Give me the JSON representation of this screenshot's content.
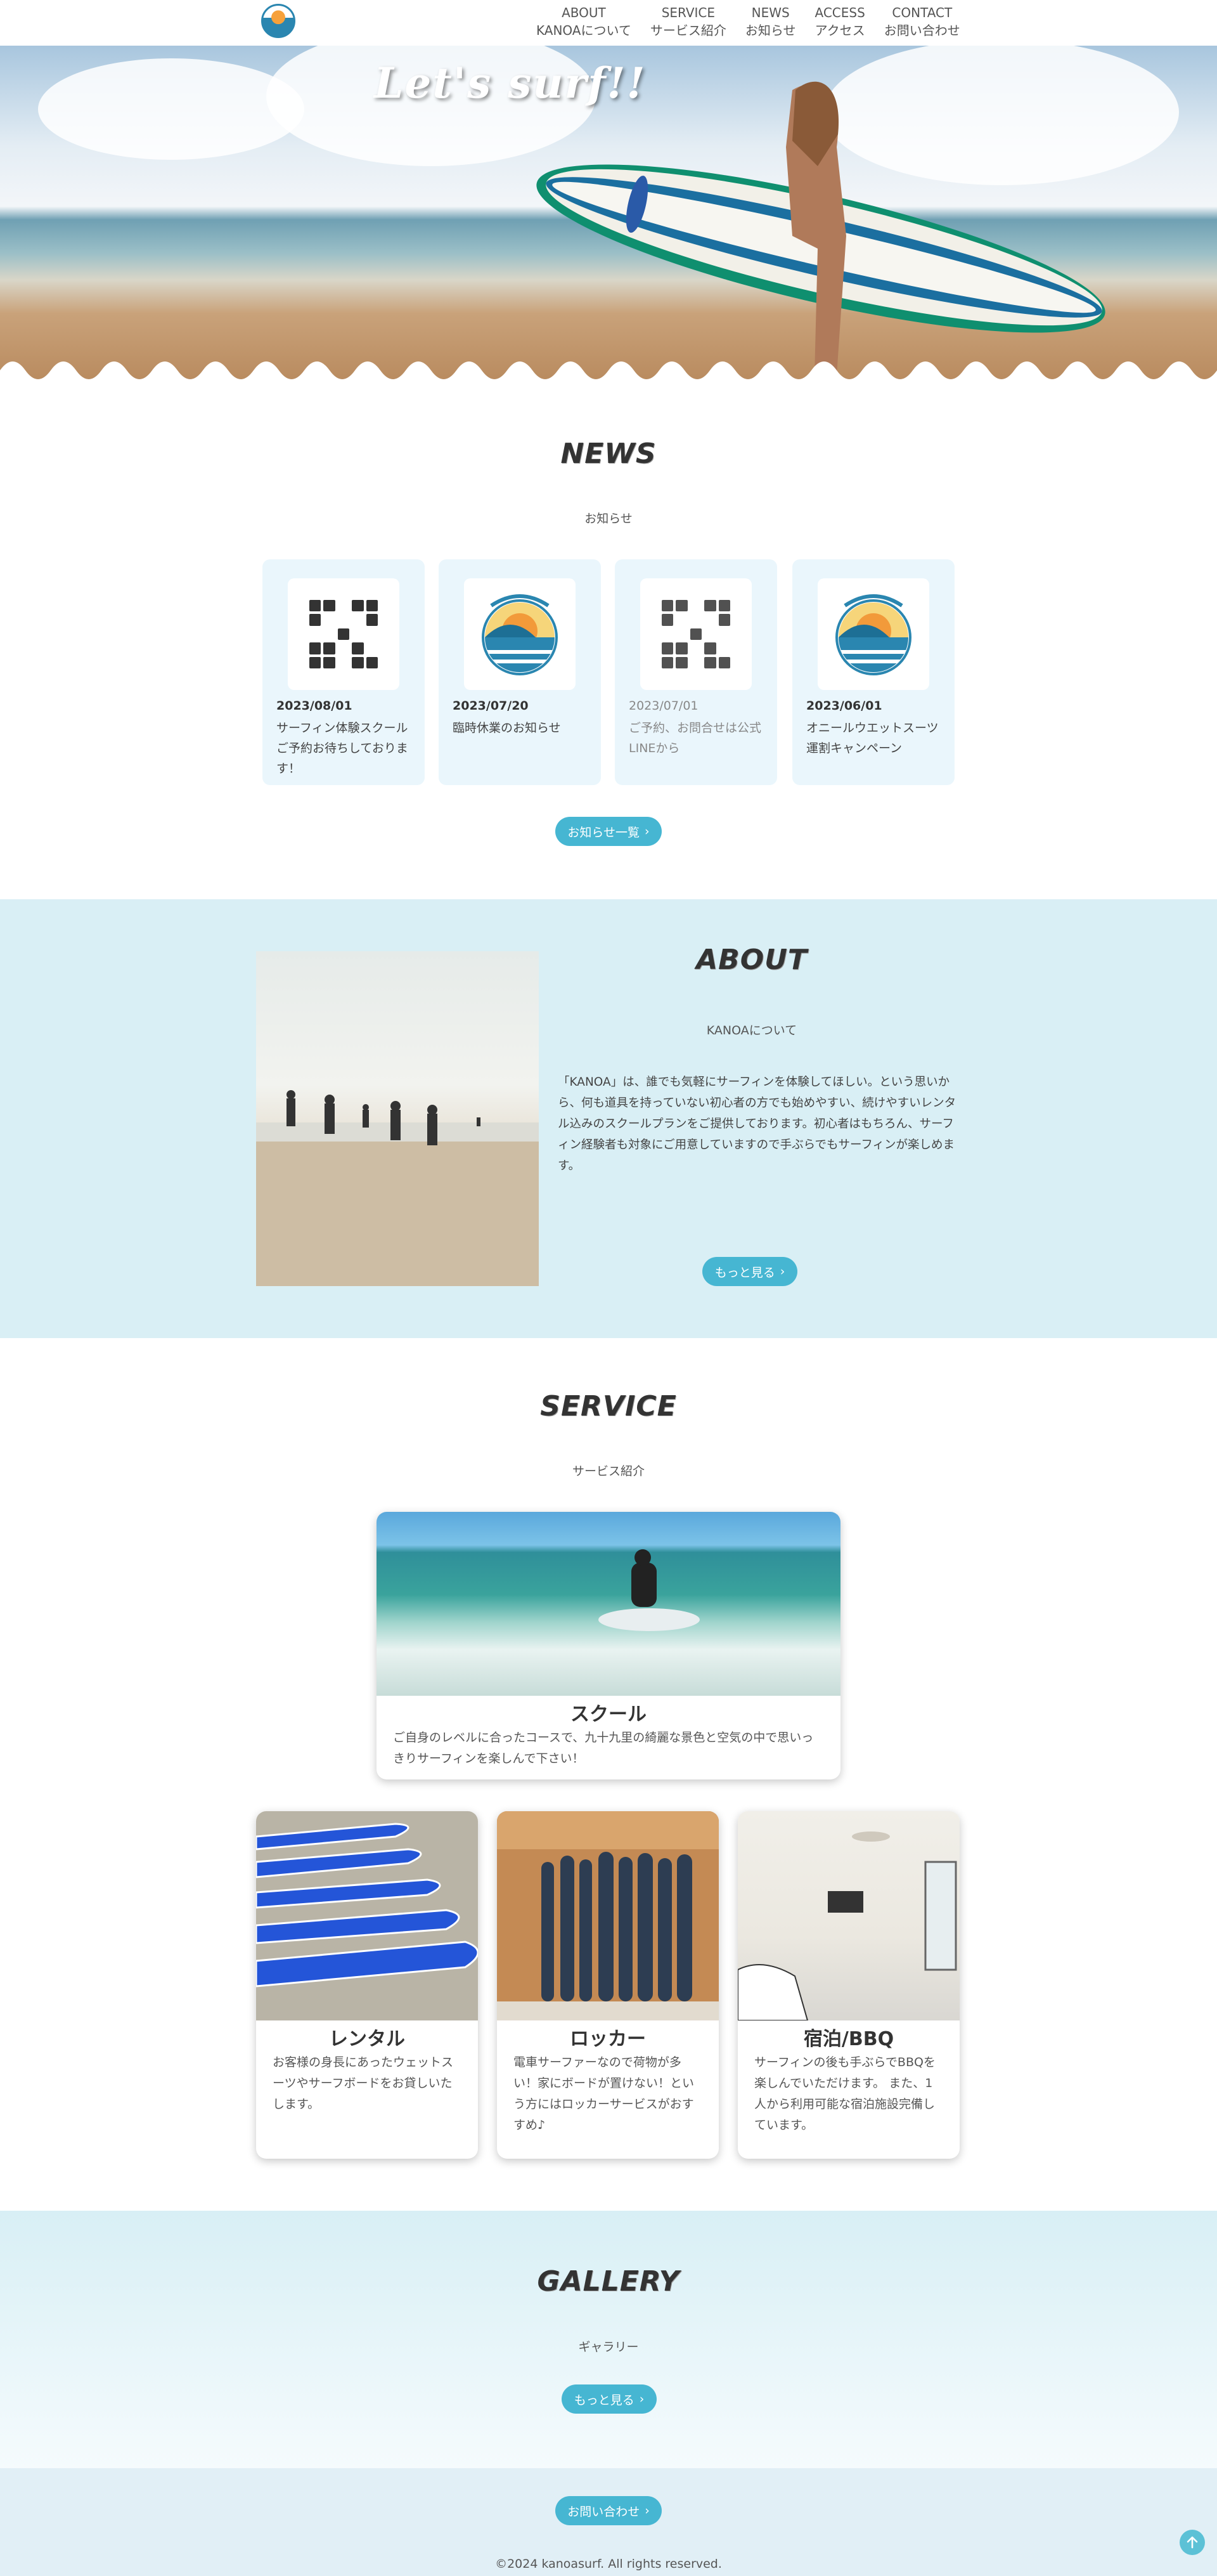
{
  "header": {
    "logo_alt": "KANOA SURF",
    "nav": [
      {
        "en": "ABOUT",
        "ja": "KANOAについて"
      },
      {
        "en": "SERVICE",
        "ja": "サービス紹介"
      },
      {
        "en": "NEWS",
        "ja": "お知らせ"
      },
      {
        "en": "ACCESS",
        "ja": "アクセス"
      },
      {
        "en": "CONTACT",
        "ja": "お問い合わせ"
      }
    ]
  },
  "hero": {
    "title": "Let's surf!!"
  },
  "news": {
    "title": "NEWS",
    "subtitle": "お知らせ",
    "items": [
      {
        "date": "2023/08/01",
        "text": "サーフィン体験スクールご予約お待ちしております！",
        "thumb": "qr-code-icon"
      },
      {
        "date": "2023/07/20",
        "text": "臨時休業のお知らせ",
        "thumb": "kanoa-surf-emblem"
      },
      {
        "date": "2023/07/01",
        "text": "ご予約、お問合せは公式LINEから",
        "thumb": "qr-code-icon"
      },
      {
        "date": "2023/06/01",
        "text": "オニールウエットスーツ運割キャンペーン",
        "thumb": "kanoa-surf-emblem"
      }
    ],
    "more_label": "お知らせ一覧"
  },
  "about": {
    "title": "ABOUT",
    "subtitle": "KANOAについて",
    "body": "「KANOA」は、誰でも気軽にサーフィンを体験してほしい。という思いから、何も道具を持っていない初心者の方でも始めやすい、続けやすいレンタル込みのスクールプランをご提供しております。初心者はもちろん、サーフィン経験者も対象にご用意していますので手ぶらでもサーフィンが楽しめます。",
    "more_label": "もっと見る"
  },
  "service": {
    "title": "SERVICE",
    "subtitle": "サービス紹介",
    "main": {
      "title": "スクール",
      "text": "ご自身のレベルに合ったコースで、九十九里の綺麗な景色と空気の中で思いっきりサーフィンを楽しんで下さい！"
    },
    "cards": [
      {
        "title": "レンタル",
        "text": "お客様の身長にあったウェットスーツやサーフボードをお貸しいたします。"
      },
      {
        "title": "ロッカー",
        "text": "電車サーファーなので荷物が多い！家にボードが置けない！という方にはロッカーサービスがおすすめ♪"
      },
      {
        "title": "宿泊/BBQ",
        "text": "サーフィンの後も手ぶらでBBQを楽しんでいただけます。 また、1人から利用可能な宿泊施設完備しています。"
      }
    ]
  },
  "gallery": {
    "title": "GALLERY",
    "subtitle": "ギャラリー",
    "more_label": "もっと見る"
  },
  "footer": {
    "contact_label": "お問い合わせ",
    "copyright": "©2024 kanoasurf. All rights reserved."
  },
  "colors": {
    "accent": "#46b6d2",
    "about_bg": "#d9eff5",
    "news_card_bg": "#eaf6fc"
  }
}
